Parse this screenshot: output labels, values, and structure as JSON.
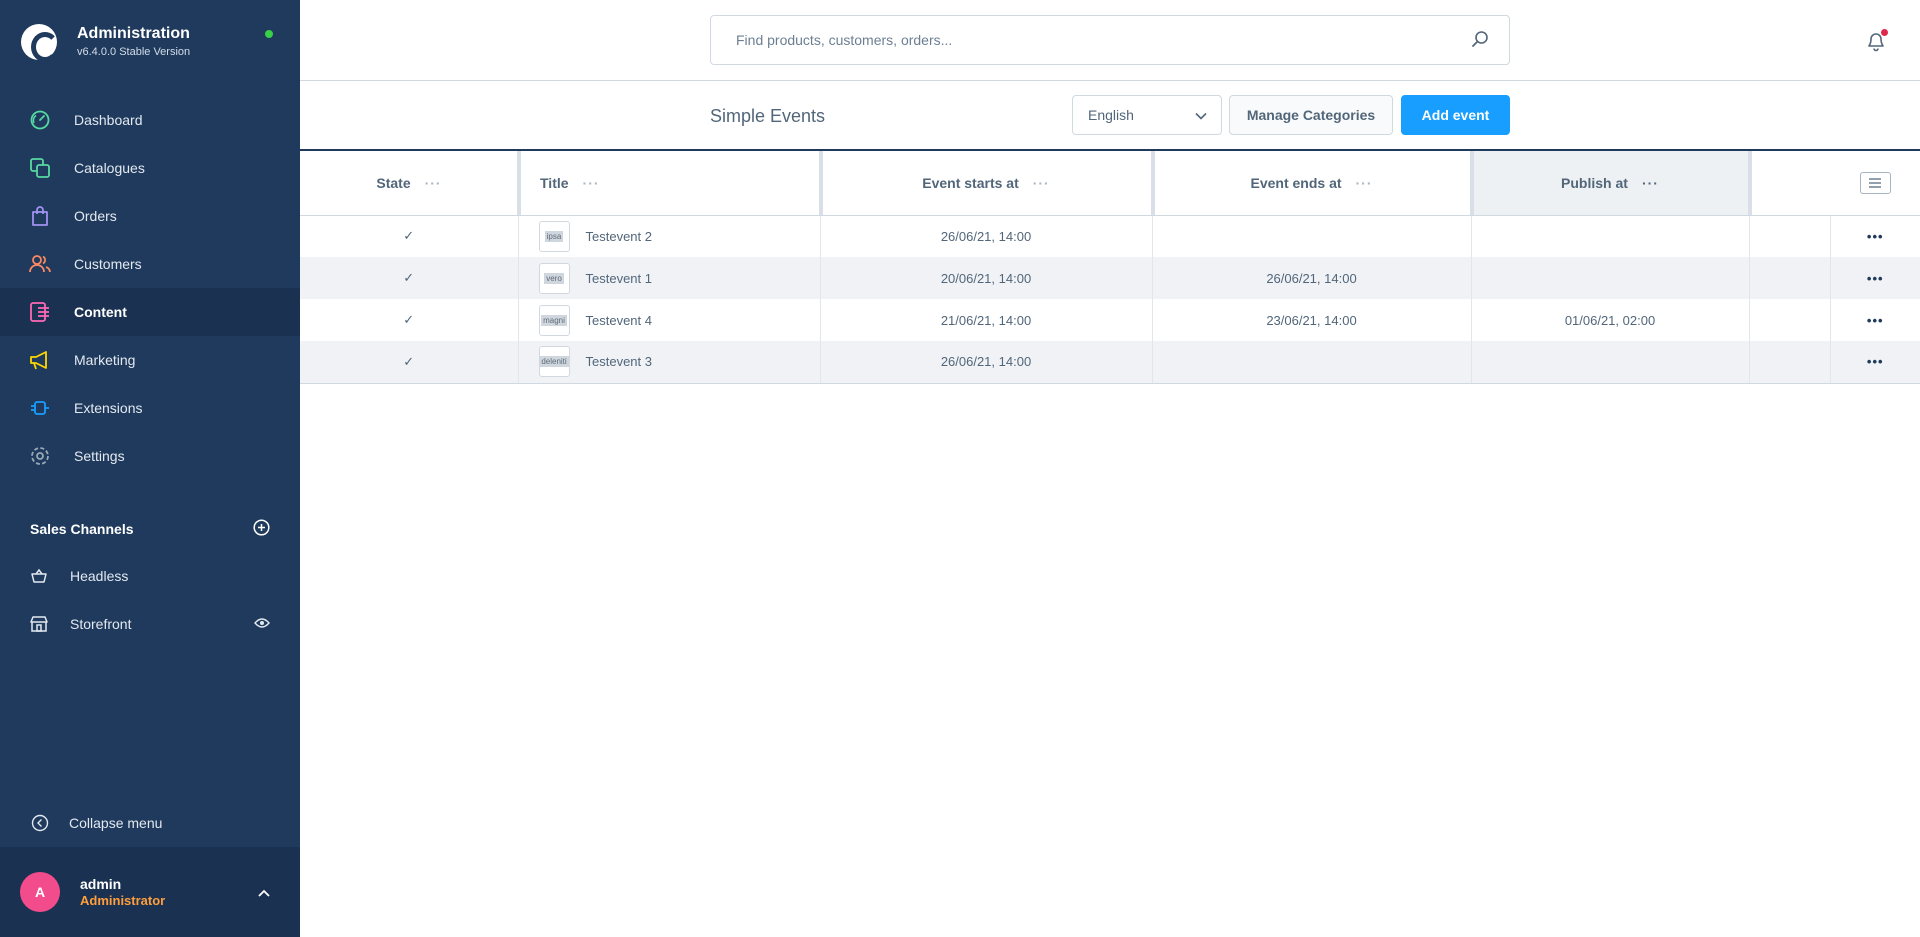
{
  "app": {
    "title": "Administration",
    "version": "v6.4.0.0 Stable Version"
  },
  "sidebar": {
    "items": [
      {
        "label": "Dashboard",
        "icon": "dashboard-icon",
        "color": "#57d9a3"
      },
      {
        "label": "Catalogues",
        "icon": "catalogues-icon",
        "color": "#57d9a3"
      },
      {
        "label": "Orders",
        "icon": "orders-icon",
        "color": "#a092f0"
      },
      {
        "label": "Customers",
        "icon": "customers-icon",
        "color": "#f88962"
      },
      {
        "label": "Content",
        "icon": "content-icon",
        "color": "#ff68b4"
      },
      {
        "label": "Marketing",
        "icon": "marketing-icon",
        "color": "#ffd700"
      },
      {
        "label": "Extensions",
        "icon": "extensions-icon",
        "color": "#189eff"
      },
      {
        "label": "Settings",
        "icon": "settings-icon",
        "color": "#9aa8b5"
      }
    ],
    "active": "Content",
    "sales_channels_title": "Sales Channels",
    "sales_channels": [
      {
        "label": "Headless",
        "icon": "basket-icon"
      },
      {
        "label": "Storefront",
        "icon": "storefront-icon"
      }
    ],
    "collapse_label": "Collapse menu",
    "user": {
      "initial": "A",
      "name": "admin",
      "role": "Administrator"
    }
  },
  "search": {
    "placeholder": "Find products, customers, orders..."
  },
  "smartbar": {
    "title": "Simple Events",
    "language": "English",
    "manage_categories": "Manage Categories",
    "add_event": "Add event"
  },
  "grid": {
    "columns": [
      "State",
      "Title",
      "Event starts at",
      "Event ends at",
      "Publish at"
    ],
    "rows": [
      {
        "state": "✓",
        "thumb": "ipsa",
        "title": "Testevent 2",
        "starts": "26/06/21, 14:00",
        "ends": "",
        "publish": ""
      },
      {
        "state": "✓",
        "thumb": "vero",
        "title": "Testevent 1",
        "starts": "20/06/21, 14:00",
        "ends": "26/06/21, 14:00",
        "publish": ""
      },
      {
        "state": "✓",
        "thumb": "magni",
        "title": "Testevent 4",
        "starts": "21/06/21, 14:00",
        "ends": "23/06/21, 14:00",
        "publish": "01/06/21, 02:00"
      },
      {
        "state": "✓",
        "thumb": "deleniti",
        "title": "Testevent 3",
        "starts": "26/06/21, 14:00",
        "ends": "",
        "publish": ""
      }
    ],
    "row_action": "•••",
    "header_action": "···"
  }
}
